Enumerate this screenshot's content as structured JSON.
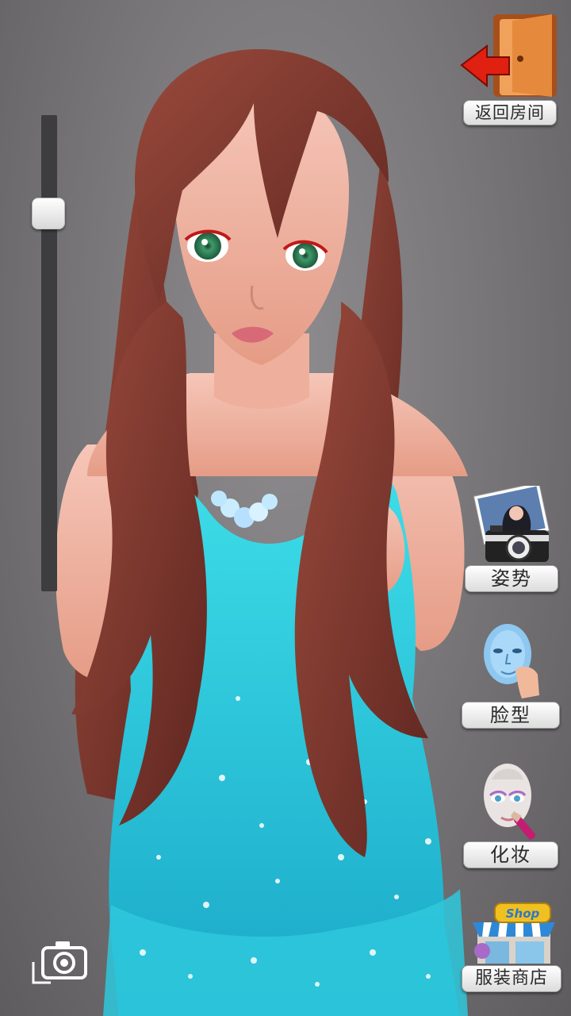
{
  "nav": {
    "back_room_label": "返回房间"
  },
  "zoom_slider": {
    "level": 0.2
  },
  "actions": {
    "pose_label": "姿势",
    "face_shape_label": "脸型",
    "makeup_label": "化妆",
    "clothing_shop_label": "服装商店",
    "shop_sign_text": "Shop"
  },
  "icons": {
    "back": "door-exit-icon",
    "pose": "photo-camera-icon",
    "face": "face-model-icon",
    "makeup": "makeup-brush-icon",
    "shop": "storefront-icon",
    "screenshot": "camera-icon"
  },
  "colors": {
    "background": "#7a787a",
    "dress": "#3fd0e0",
    "hair": "#8a3a30",
    "arrow": "#e02010",
    "door": "#d9782e"
  }
}
